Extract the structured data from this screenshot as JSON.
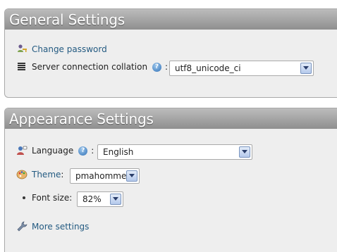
{
  "general": {
    "title": "General Settings",
    "change_password_label": "Change password",
    "collation_label": "Server connection collation",
    "collation_help": "?",
    "collation_colon": ":",
    "collation_value": "utf8_unicode_ci"
  },
  "appearance": {
    "title": "Appearance Settings",
    "language_label": "Language",
    "language_help": "?",
    "language_colon": ":",
    "language_value": "English",
    "theme_label": "Theme",
    "theme_colon": ":",
    "theme_value": "pmahomme",
    "font_size_label": "Font size:",
    "font_size_value": "82%",
    "more_settings_label": "More settings"
  },
  "icons": {
    "change_password": "key-user-icon",
    "collation": "db-list-icon",
    "language": "language-icon",
    "theme": "theme-palette-icon",
    "more_settings": "wrench-icon",
    "help": "help-icon"
  },
  "colors": {
    "link": "#235a81",
    "header_top": "#bcbcbc",
    "header_bottom": "#8f8f8f",
    "panel_bg": "#eeeeee"
  }
}
